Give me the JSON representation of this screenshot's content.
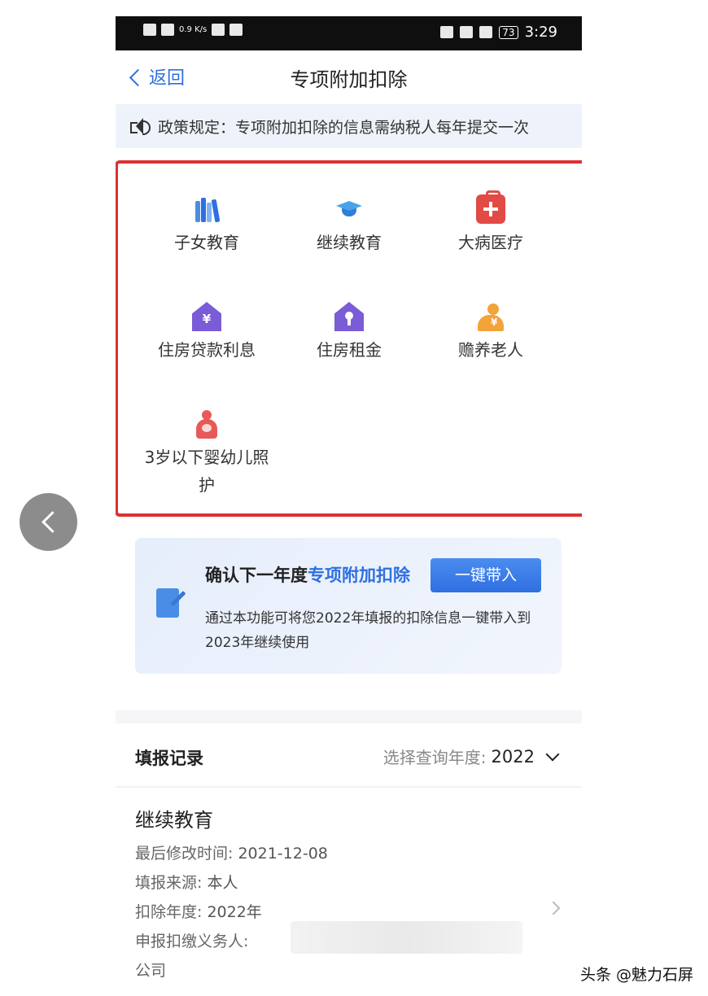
{
  "status_bar": {
    "network": "0.9\nK/s",
    "battery": "73",
    "time": "3:29"
  },
  "nav": {
    "back_label": "返回",
    "title": "专项附加扣除"
  },
  "policy": {
    "text": "政策规定：专项附加扣除的信息需纳税人每年提交一次"
  },
  "categories": [
    {
      "label": "子女教育",
      "icon": "books-icon"
    },
    {
      "label": "继续教育",
      "icon": "graduation-cap-icon"
    },
    {
      "label": "大病医疗",
      "icon": "medical-kit-icon"
    },
    {
      "label": "住房贷款利息",
      "icon": "house-yuan-icon"
    },
    {
      "label": "住房租金",
      "icon": "house-key-icon"
    },
    {
      "label": "赡养老人",
      "icon": "elder-icon"
    },
    {
      "label": "3岁以下婴幼儿照护",
      "icon": "baby-care-icon"
    }
  ],
  "onekey": {
    "title_prefix": "确认下一年度",
    "title_highlight": "专项附加扣除",
    "button": "一键带入",
    "desc": "通过本功能可将您2022年填报的扣除信息一键带入到2023年继续使用"
  },
  "records": {
    "title": "填报记录",
    "year_label": "选择查询年度:",
    "year_value": "2022",
    "item": {
      "name": "继续教育",
      "rows": [
        {
          "label": "最后修改时间:",
          "value": "2021-12-08"
        },
        {
          "label": "填报来源:",
          "value": "本人"
        },
        {
          "label": "扣除年度:",
          "value": "2022年"
        },
        {
          "label": "申报扣缴义务人:",
          "value": ""
        }
      ],
      "company_suffix": "公司"
    }
  },
  "watermark": "头条 @魅力石屏",
  "colors": {
    "accent": "#2f6fe0",
    "frame": "#d93232",
    "policy_bg": "#eef3fb"
  }
}
